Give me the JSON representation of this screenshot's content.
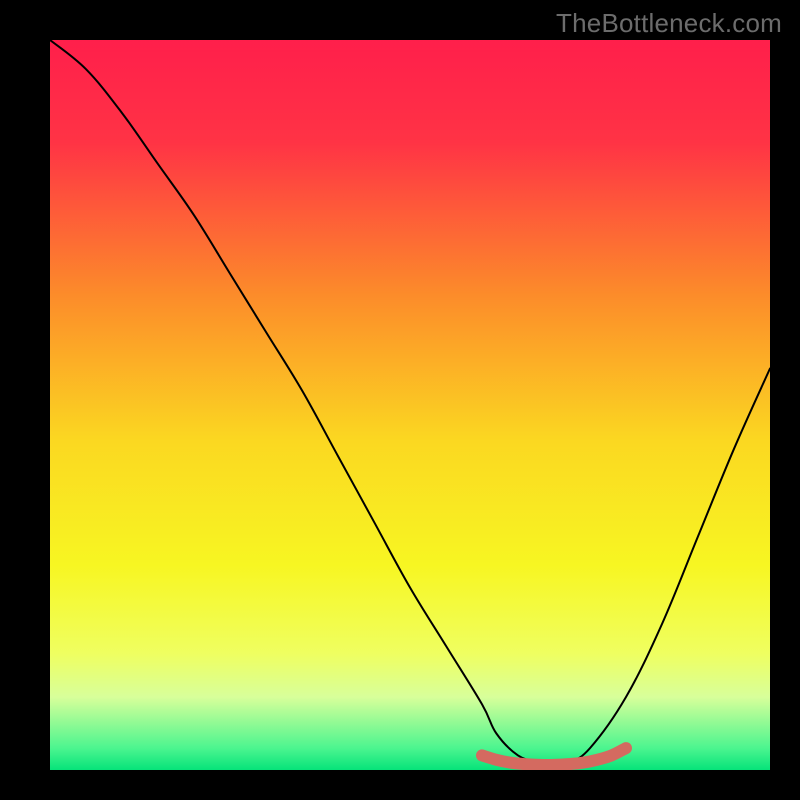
{
  "watermark": "TheBottleneck.com",
  "chart_data": {
    "type": "line",
    "title": "",
    "xlabel": "",
    "ylabel": "",
    "xlim": [
      0,
      100
    ],
    "ylim": [
      0,
      100
    ],
    "grid": false,
    "legend": false,
    "background_gradient": {
      "stops": [
        {
          "pos": 0,
          "color": "#ff1f4b"
        },
        {
          "pos": 14,
          "color": "#ff3345"
        },
        {
          "pos": 35,
          "color": "#fc8c2a"
        },
        {
          "pos": 55,
          "color": "#fbd821"
        },
        {
          "pos": 72,
          "color": "#f7f622"
        },
        {
          "pos": 84,
          "color": "#efff60"
        },
        {
          "pos": 90,
          "color": "#d8ff9a"
        },
        {
          "pos": 97,
          "color": "#4cf58f"
        },
        {
          "pos": 100,
          "color": "#06e37a"
        }
      ]
    },
    "series": [
      {
        "name": "bottleneck-curve",
        "color": "#000000",
        "x": [
          0,
          5,
          10,
          15,
          20,
          25,
          30,
          35,
          40,
          45,
          50,
          55,
          60,
          62,
          65,
          68,
          70,
          72,
          75,
          80,
          85,
          90,
          95,
          100
        ],
        "y": [
          100,
          96,
          90,
          83,
          76,
          68,
          60,
          52,
          43,
          34,
          25,
          17,
          9,
          5,
          2,
          1,
          1,
          1,
          3,
          10,
          20,
          32,
          44,
          55
        ]
      },
      {
        "name": "optimal-band",
        "color": "#d46a60",
        "style": "thick-rounded",
        "x": [
          60,
          62,
          64,
          66,
          68,
          70,
          72,
          74,
          76,
          78,
          80
        ],
        "y": [
          2.0,
          1.4,
          1.0,
          0.8,
          0.7,
          0.7,
          0.8,
          1.0,
          1.4,
          2.0,
          3.0
        ]
      }
    ]
  }
}
